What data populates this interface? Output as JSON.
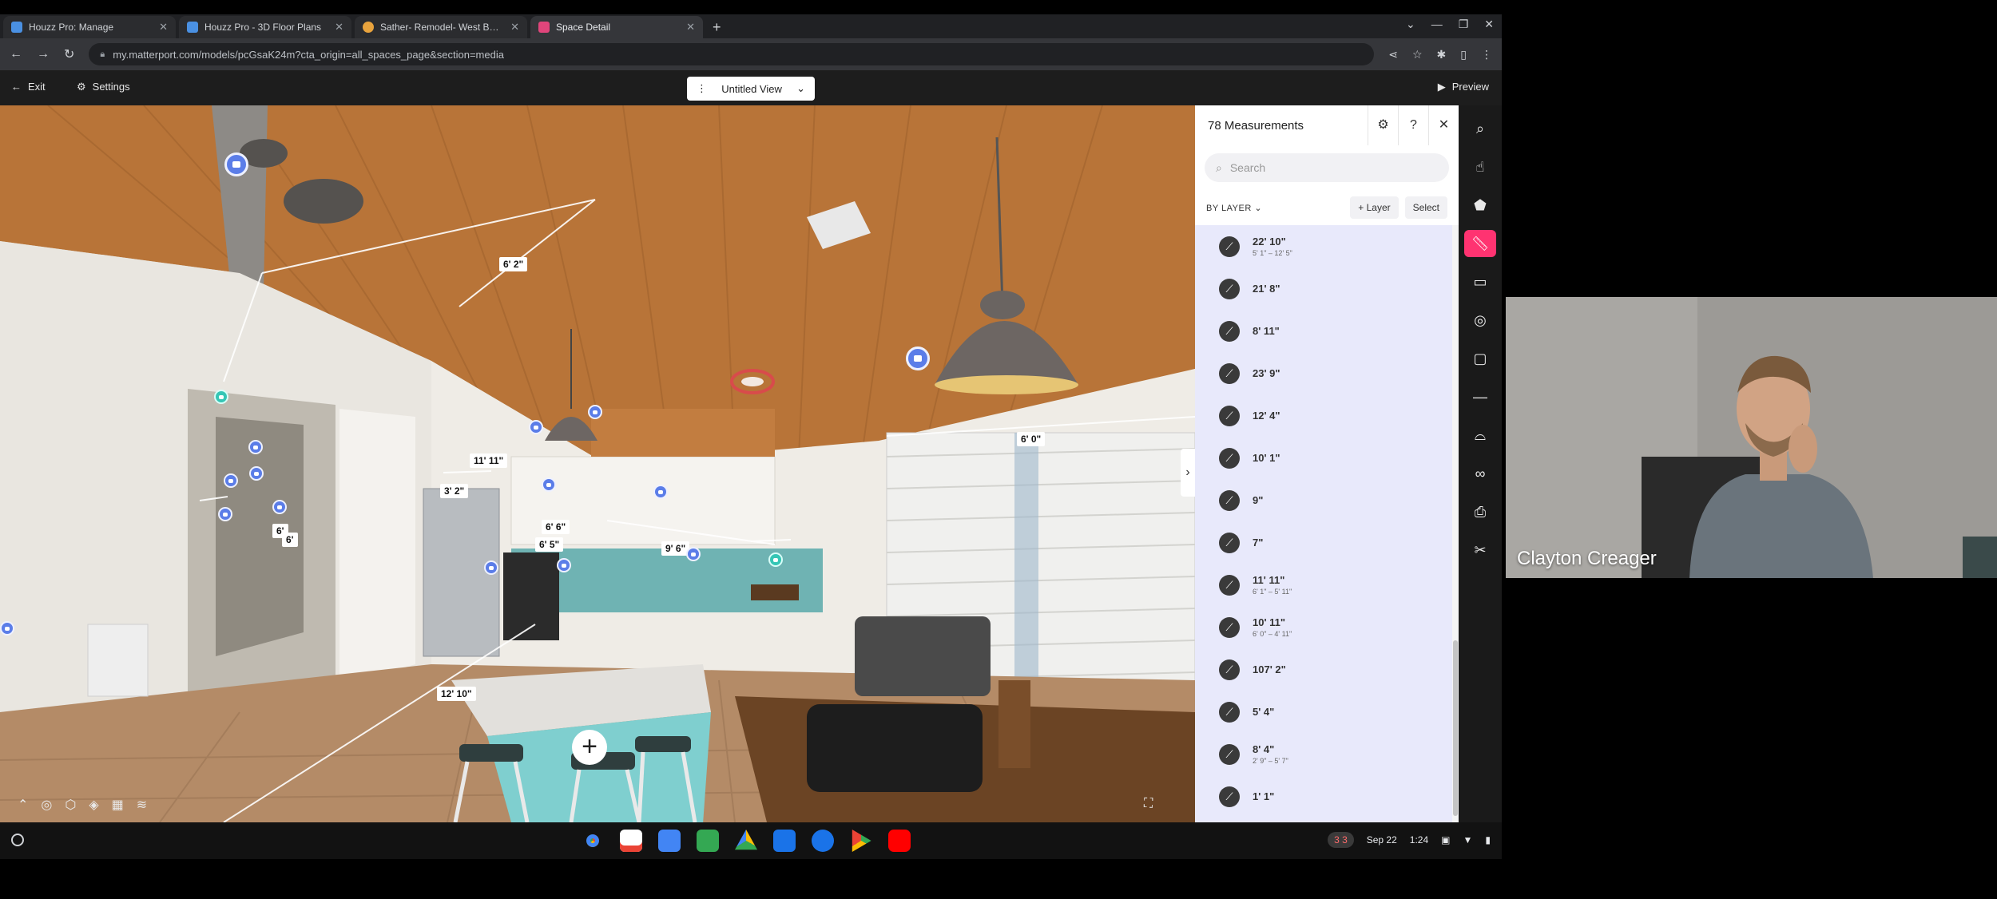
{
  "browser": {
    "tabs": [
      {
        "title": "Houzz Pro: Manage",
        "favicon_color": "#4a90e2",
        "active": false
      },
      {
        "title": "Houzz Pro - 3D Floor Plans",
        "favicon_color": "#4a90e2",
        "active": false
      },
      {
        "title": "Sather- Remodel- West Beach: C",
        "favicon_color": "#e8a33d",
        "active": false
      },
      {
        "title": "Space Detail",
        "favicon_color": "#e0457b",
        "active": true
      }
    ],
    "new_tab_icon": "plus-icon",
    "url": "my.matterport.com/models/pcGsaK24m?cta_origin=all_spaces_page&section=media"
  },
  "app_header": {
    "exit_label": "Exit",
    "settings_label": "Settings",
    "view_name": "Untitled View",
    "preview_label": "Preview"
  },
  "viewport": {
    "labels": [
      "6' 2\"",
      "6' 0\"",
      "11' 11\"",
      "3' 2\"",
      "6' 6\"",
      "6' 5\"",
      "9' 6\"",
      "6'",
      "6'",
      "12' 10\""
    ]
  },
  "panel": {
    "title": "78 Measurements",
    "search_placeholder": "Search",
    "filter_label": "BY LAYER",
    "layer_button": "Layer",
    "select_button": "Select",
    "items": [
      {
        "value": "22' 10\"",
        "sub": "5' 1\" – 12' 5\""
      },
      {
        "value": "21' 8\"",
        "sub": ""
      },
      {
        "value": "8' 11\"",
        "sub": ""
      },
      {
        "value": "23' 9\"",
        "sub": ""
      },
      {
        "value": "12' 4\"",
        "sub": ""
      },
      {
        "value": "10' 1\"",
        "sub": ""
      },
      {
        "value": "9\"",
        "sub": ""
      },
      {
        "value": "7\"",
        "sub": ""
      },
      {
        "value": "11' 11\"",
        "sub": "6' 1\" – 5' 11\""
      },
      {
        "value": "10' 11\"",
        "sub": "6' 0\" – 4' 11\""
      },
      {
        "value": "107' 2\"",
        "sub": ""
      },
      {
        "value": "5' 4\"",
        "sub": ""
      },
      {
        "value": "8' 4\"",
        "sub": "2' 9\" – 5' 7\""
      },
      {
        "value": "1' 1\"",
        "sub": ""
      }
    ]
  },
  "shelf": {
    "date": "Sep 22",
    "time": "1:24",
    "badge": "3 3"
  },
  "webcam": {
    "participant_name": "Clayton Creager"
  },
  "colors": {
    "accent": "#ff3371",
    "list_bg": "#e8e9fb",
    "pin_blue": "#5b7de8",
    "pin_teal": "#35c6b5"
  }
}
